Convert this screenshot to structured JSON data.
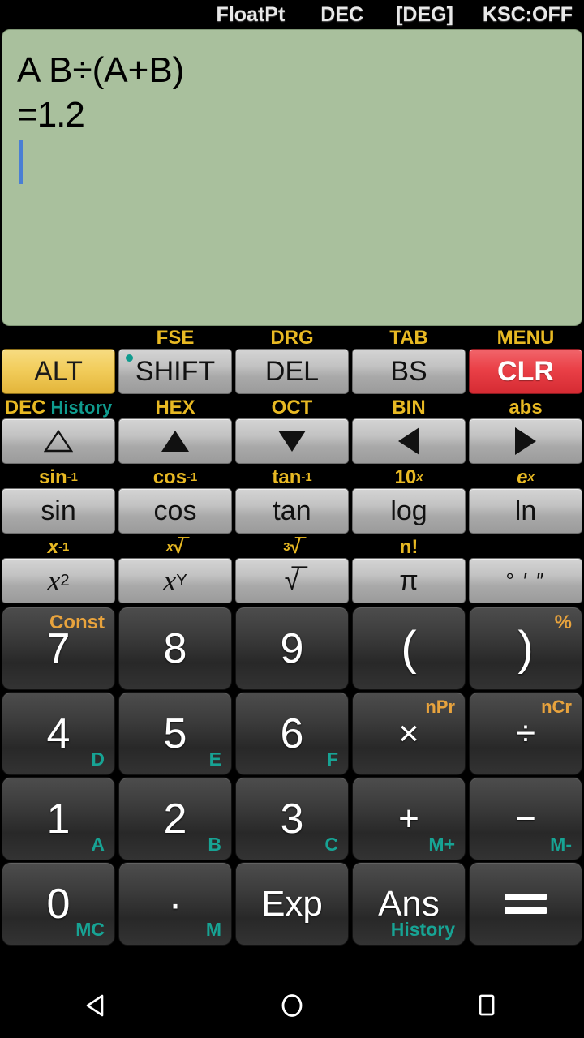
{
  "statusbar": {
    "float_mode": "FloatPt",
    "base_mode": "DEC",
    "angle_mode": "[DEG]",
    "ksc": "KSC:OFF"
  },
  "display": {
    "expression": "A B÷(A+B)",
    "result": "=1.2",
    "background_color": "#a9c09d",
    "caret_color": "#4a7fd4"
  },
  "colors": {
    "amber_label": "#e8b923",
    "teal_label": "#17a394",
    "orange_label": "#e8a33d",
    "alt_key": "#f2cd5c",
    "clr_key": "#ea4047"
  },
  "keypad": {
    "row1": {
      "labels": [
        "",
        "FSE",
        "DRG",
        "TAB",
        "MENU"
      ],
      "keys": [
        "ALT",
        "SHIFT",
        "DEL",
        "BS",
        "CLR"
      ]
    },
    "row2": {
      "labels": [
        "DEC",
        "HEX",
        "OCT",
        "BIN",
        "abs"
      ],
      "label_extra": "History",
      "keys": [
        "triangle-up-outline",
        "triangle-up",
        "triangle-down",
        "triangle-left",
        "triangle-right"
      ]
    },
    "row3": {
      "labels": [
        "sin-1",
        "cos-1",
        "tan-1",
        "10x",
        "ex"
      ],
      "labels_base": [
        "sin",
        "cos",
        "tan",
        "10",
        "e"
      ],
      "labels_sup": [
        "-1",
        "-1",
        "-1",
        "x",
        "x"
      ],
      "keys": [
        "sin",
        "cos",
        "tan",
        "log",
        "ln"
      ]
    },
    "row4": {
      "labels_base": [
        "x",
        "x",
        "3",
        "n!",
        ""
      ],
      "labels_sup": [
        "-1",
        "",
        "",
        "",
        ""
      ],
      "labels_text": [
        "x-1",
        "x√",
        "3√",
        "n!",
        ""
      ],
      "keys": [
        "x2",
        "xY",
        "sqrt",
        "pi",
        "dms"
      ],
      "key_glyphs": [
        "x",
        "x",
        "√",
        "π",
        "° ′ ″"
      ],
      "key_sups": [
        "2",
        "Y",
        "",
        "",
        ""
      ]
    },
    "numpad": [
      [
        {
          "main": "7",
          "tr": "Const",
          "br": ""
        },
        {
          "main": "8",
          "tr": "",
          "br": ""
        },
        {
          "main": "9",
          "tr": "",
          "br": ""
        },
        {
          "main": "(",
          "tr": "",
          "br": ""
        },
        {
          "main": ")",
          "tr": "%",
          "br": ""
        }
      ],
      [
        {
          "main": "4",
          "tr": "",
          "br": "D"
        },
        {
          "main": "5",
          "tr": "",
          "br": "E"
        },
        {
          "main": "6",
          "tr": "",
          "br": "F"
        },
        {
          "main": "×",
          "tr": "nPr",
          "br": ""
        },
        {
          "main": "÷",
          "tr": "nCr",
          "br": ""
        }
      ],
      [
        {
          "main": "1",
          "tr": "",
          "br": "A"
        },
        {
          "main": "2",
          "tr": "",
          "br": "B"
        },
        {
          "main": "3",
          "tr": "",
          "br": "C"
        },
        {
          "main": "+",
          "tr": "",
          "br": "M+"
        },
        {
          "main": "−",
          "tr": "",
          "br": "M-"
        }
      ],
      [
        {
          "main": "0",
          "tr": "",
          "br": "MC"
        },
        {
          "main": "·",
          "tr": "",
          "br": "M"
        },
        {
          "main": "Exp",
          "tr": "",
          "br": ""
        },
        {
          "main": "Ans",
          "tr": "",
          "br": "History"
        },
        {
          "main": "=",
          "tr": "",
          "br": ""
        }
      ]
    ]
  },
  "navbar": {
    "back": "back-icon",
    "home": "home-icon",
    "recents": "recents-icon"
  }
}
